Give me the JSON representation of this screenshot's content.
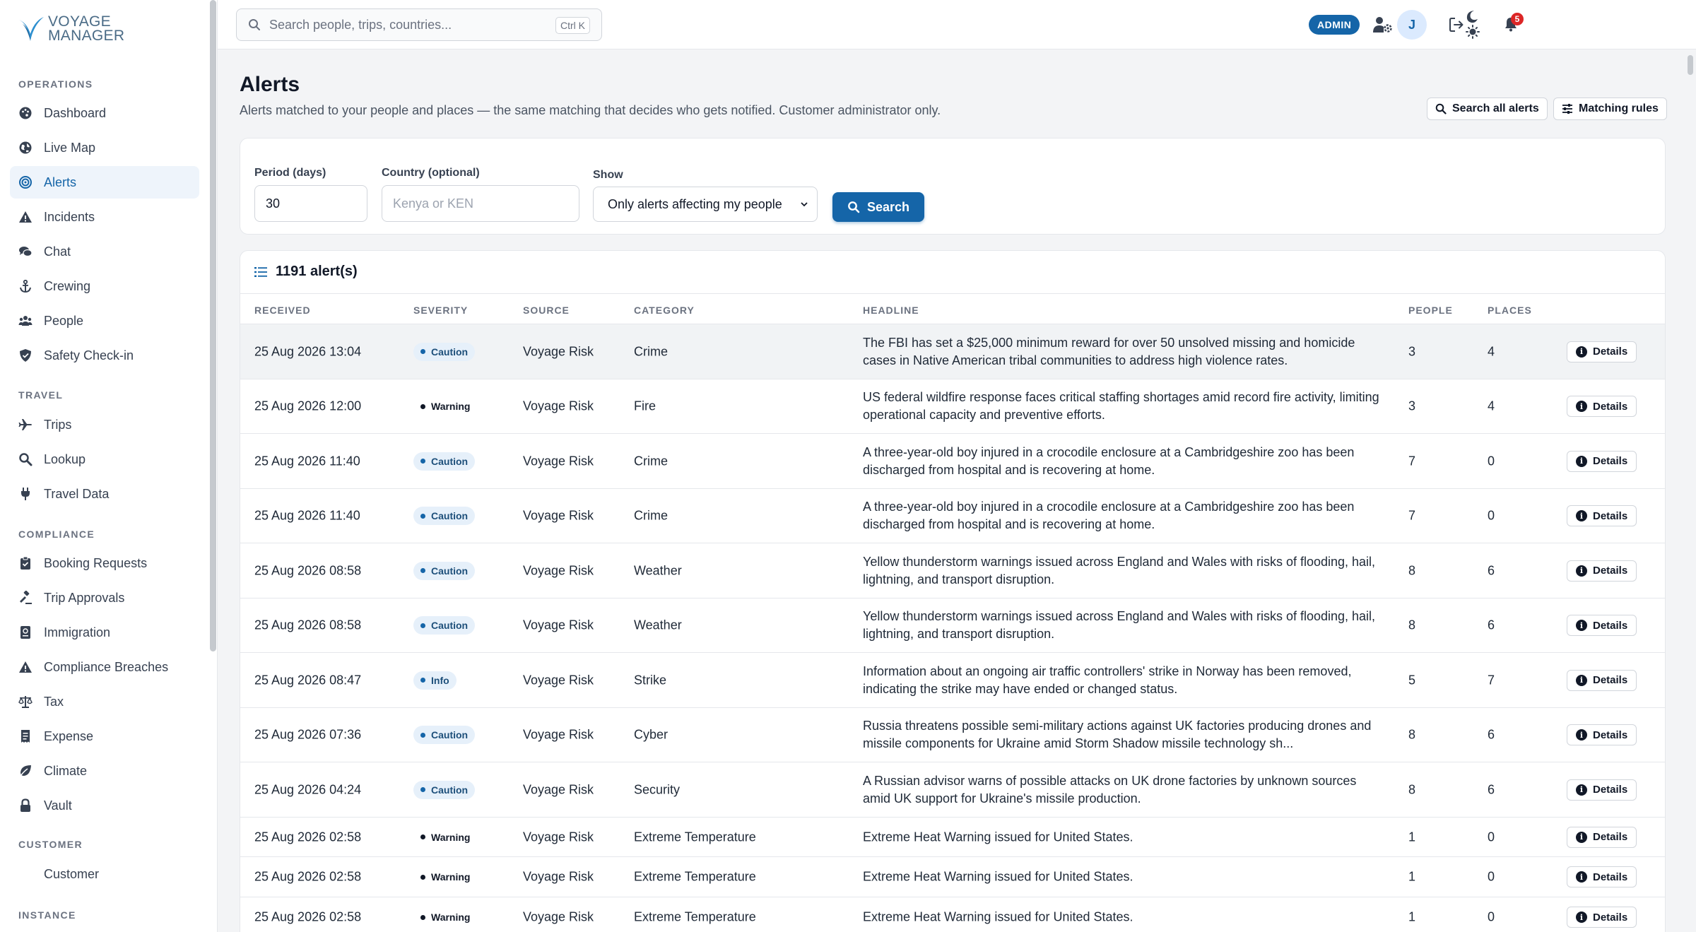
{
  "brand": {
    "line1": "VOYAGE",
    "line2": "MANAGER"
  },
  "sidebar": {
    "sections": [
      {
        "label": "OPERATIONS",
        "items": [
          {
            "label": "Dashboard",
            "icon": "palette-icon"
          },
          {
            "label": "Live Map",
            "icon": "globe-icon"
          },
          {
            "label": "Alerts",
            "icon": "target-icon",
            "active": true
          },
          {
            "label": "Incidents",
            "icon": "warning-icon"
          },
          {
            "label": "Chat",
            "icon": "chat-icon"
          },
          {
            "label": "Crewing",
            "icon": "anchor-icon"
          },
          {
            "label": "People",
            "icon": "people-icon"
          },
          {
            "label": "Safety Check-in",
            "icon": "shield-icon"
          }
        ]
      },
      {
        "label": "TRAVEL",
        "items": [
          {
            "label": "Trips",
            "icon": "plane-icon"
          },
          {
            "label": "Lookup",
            "icon": "search-icon"
          },
          {
            "label": "Travel Data",
            "icon": "plug-icon"
          }
        ]
      },
      {
        "label": "COMPLIANCE",
        "items": [
          {
            "label": "Booking Requests",
            "icon": "clipboard-icon"
          },
          {
            "label": "Trip Approvals",
            "icon": "gavel-icon"
          },
          {
            "label": "Immigration",
            "icon": "passport-icon"
          },
          {
            "label": "Compliance Breaches",
            "icon": "warning-icon"
          },
          {
            "label": "Tax",
            "icon": "scale-icon"
          },
          {
            "label": "Expense",
            "icon": "receipt-icon"
          },
          {
            "label": "Climate",
            "icon": "leaf-icon"
          },
          {
            "label": "Vault",
            "icon": "lock-icon"
          }
        ]
      },
      {
        "label": "CUSTOMER",
        "items": [
          {
            "label": "Customer",
            "icon": ""
          }
        ]
      },
      {
        "label": "INSTANCE",
        "items": []
      }
    ]
  },
  "topbar": {
    "search_placeholder": "Search people, trips, countries...",
    "search_shortcut": "Ctrl K",
    "notification_count": "5",
    "role_badge": "ADMIN",
    "avatar_initial": "J"
  },
  "header": {
    "title": "Alerts",
    "subtitle": "Alerts matched to your people and places — the same matching that decides who gets notified. Customer administrator only.",
    "search_all_label": "Search all alerts",
    "matching_rules_label": "Matching rules"
  },
  "filters": {
    "period_label": "Period (days)",
    "period_value": "30",
    "country_label": "Country (optional)",
    "country_placeholder": "Kenya or KEN",
    "show_label": "Show",
    "show_value": "Only alerts affecting my people",
    "search_button": "Search"
  },
  "results": {
    "count_label": "1191 alert(s)",
    "columns": [
      "RECEIVED",
      "SEVERITY",
      "SOURCE",
      "CATEGORY",
      "HEADLINE",
      "PEOPLE",
      "PLACES"
    ],
    "details_label": "Details",
    "rows": [
      {
        "received": "25 Aug 2026 13:04",
        "severity": "Caution",
        "source": "Voyage Risk",
        "category": "Crime",
        "headline": "The FBI has set a $25,000 minimum reward for over 50 unsolved missing and homicide cases in Native American tribal communities to address high violence rates.",
        "people": "3",
        "places": "4"
      },
      {
        "received": "25 Aug 2026 12:00",
        "severity": "Warning",
        "source": "Voyage Risk",
        "category": "Fire",
        "headline": "US federal wildfire response faces critical staffing shortages amid record fire activity, limiting operational capacity and preventive efforts.",
        "people": "3",
        "places": "4"
      },
      {
        "received": "25 Aug 2026 11:40",
        "severity": "Caution",
        "source": "Voyage Risk",
        "category": "Crime",
        "headline": "A three-year-old boy injured in a crocodile enclosure at a Cambridgeshire zoo has been discharged from hospital and is recovering at home.",
        "people": "7",
        "places": "0"
      },
      {
        "received": "25 Aug 2026 11:40",
        "severity": "Caution",
        "source": "Voyage Risk",
        "category": "Crime",
        "headline": "A three-year-old boy injured in a crocodile enclosure at a Cambridgeshire zoo has been discharged from hospital and is recovering at home.",
        "people": "7",
        "places": "0"
      },
      {
        "received": "25 Aug 2026 08:58",
        "severity": "Caution",
        "source": "Voyage Risk",
        "category": "Weather",
        "headline": "Yellow thunderstorm warnings issued across England and Wales with risks of flooding, hail, lightning, and transport disruption.",
        "people": "8",
        "places": "6"
      },
      {
        "received": "25 Aug 2026 08:58",
        "severity": "Caution",
        "source": "Voyage Risk",
        "category": "Weather",
        "headline": "Yellow thunderstorm warnings issued across England and Wales with risks of flooding, hail, lightning, and transport disruption.",
        "people": "8",
        "places": "6"
      },
      {
        "received": "25 Aug 2026 08:47",
        "severity": "Info",
        "source": "Voyage Risk",
        "category": "Strike",
        "headline": "Information about an ongoing air traffic controllers' strike in Norway has been removed, indicating the strike may have ended or changed status.",
        "people": "5",
        "places": "7"
      },
      {
        "received": "25 Aug 2026 07:36",
        "severity": "Caution",
        "source": "Voyage Risk",
        "category": "Cyber",
        "headline": "Russia threatens possible semi-military actions against UK factories producing drones and missile components for Ukraine amid Storm Shadow missile technology sh...",
        "people": "8",
        "places": "6"
      },
      {
        "received": "25 Aug 2026 04:24",
        "severity": "Caution",
        "source": "Voyage Risk",
        "category": "Security",
        "headline": "A Russian advisor warns of possible attacks on UK drone factories by unknown sources amid UK support for Ukraine's missile production.",
        "people": "8",
        "places": "6"
      },
      {
        "received": "25 Aug 2026 02:58",
        "severity": "Warning",
        "source": "Voyage Risk",
        "category": "Extreme Temperature",
        "headline": "Extreme Heat Warning issued for United States.",
        "people": "1",
        "places": "0"
      },
      {
        "received": "25 Aug 2026 02:58",
        "severity": "Warning",
        "source": "Voyage Risk",
        "category": "Extreme Temperature",
        "headline": "Extreme Heat Warning issued for United States.",
        "people": "1",
        "places": "0"
      },
      {
        "received": "25 Aug 2026 02:58",
        "severity": "Warning",
        "source": "Voyage Risk",
        "category": "Extreme Temperature",
        "headline": "Extreme Heat Warning issued for United States.",
        "people": "1",
        "places": "0"
      }
    ]
  }
}
